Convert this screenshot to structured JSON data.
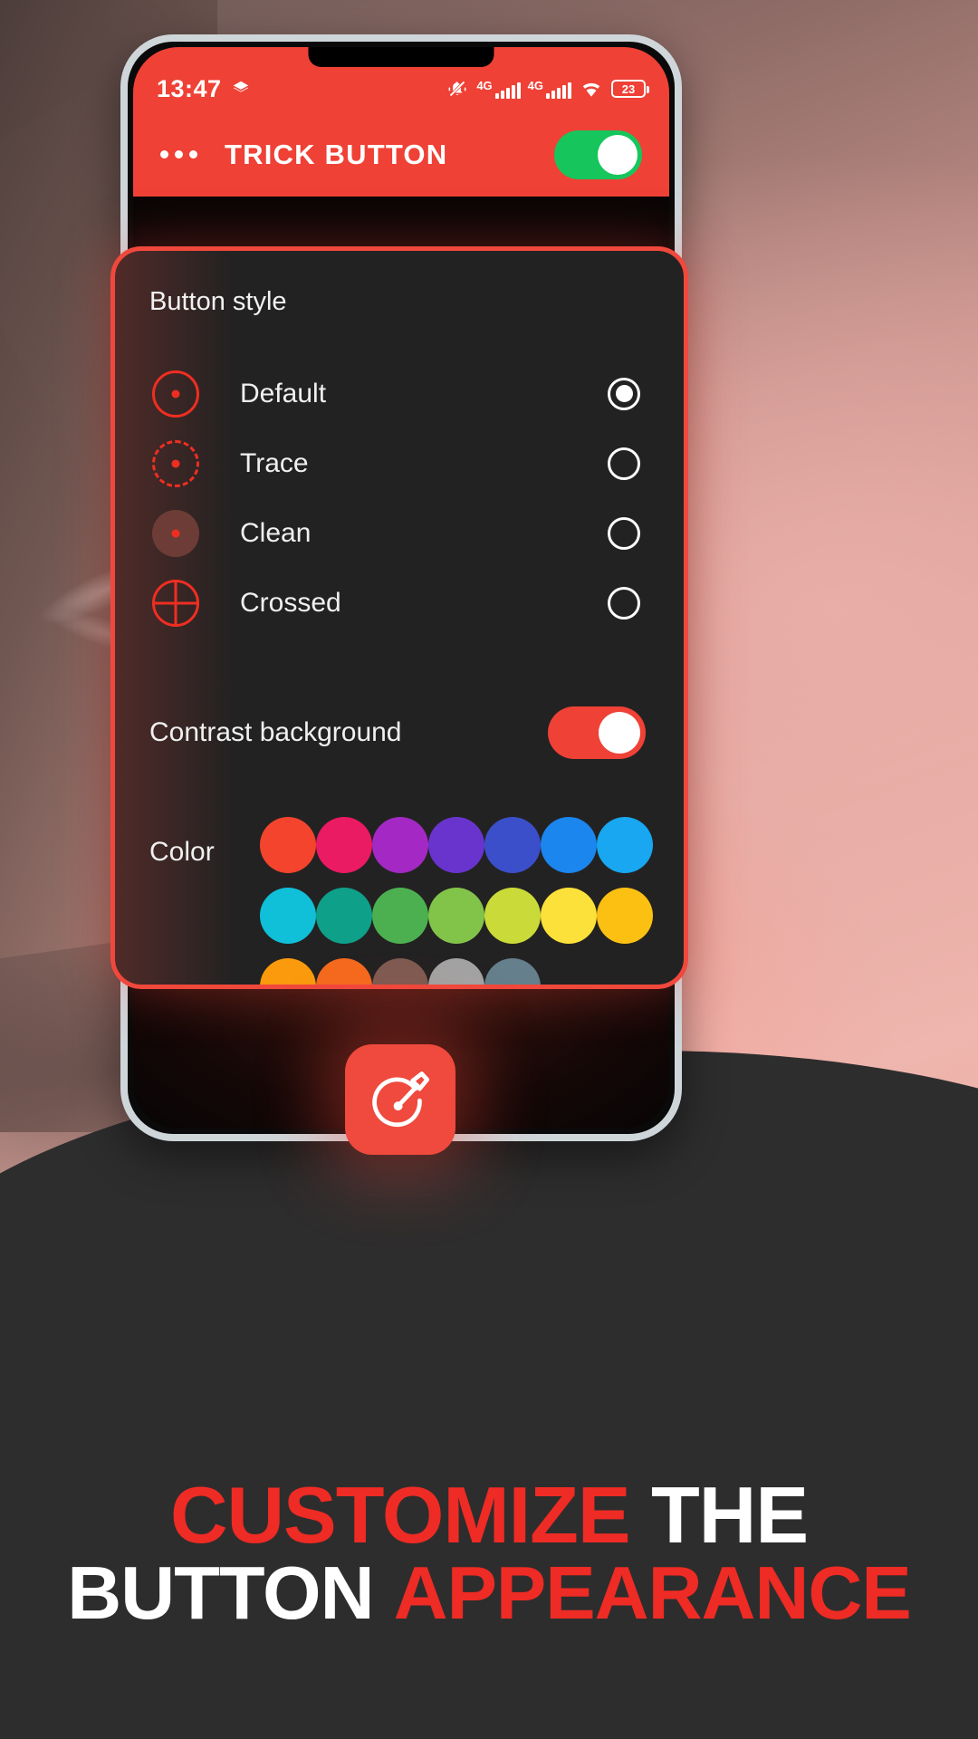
{
  "statusbar": {
    "clock": "13:47",
    "icons": [
      "layers-icon",
      "mute-bell-icon",
      "signal-4g-icon",
      "signal-4g-icon-2",
      "wifi-icon",
      "battery-icon"
    ],
    "network_label_1": "4G",
    "network_label_2": "4G",
    "battery_level": "23"
  },
  "appbar": {
    "title": "TRICK BUTTON",
    "overflow_icon": "overflow-menu-icon",
    "master_toggle_state": "on",
    "master_toggle_color": "#16c65c",
    "background_color": "#ef4136"
  },
  "dialog": {
    "border_color": "#f1483c",
    "background_color": "#232222",
    "button_style": {
      "title": "Button style",
      "selected": "Default",
      "options": [
        {
          "label": "Default",
          "icon": "ring-solid-dot-icon",
          "selected": true
        },
        {
          "label": "Trace",
          "icon": "ring-dashed-dot-icon",
          "selected": false
        },
        {
          "label": "Clean",
          "icon": "disc-muted-dot-icon",
          "selected": false
        },
        {
          "label": "Crossed",
          "icon": "ring-crosshair-icon",
          "selected": false
        }
      ]
    },
    "contrast": {
      "label": "Contrast background",
      "state": "on",
      "toggle_color": "#ef4136"
    },
    "color": {
      "label": "Color",
      "selected": "#f4442e",
      "swatches": [
        "#f4442e",
        "#ea1a63",
        "#a429c4",
        "#6934ce",
        "#3b4fca",
        "#1a86ee",
        "#18a7f0",
        "#10bfd8",
        "#0fa08a",
        "#4cb050",
        "#82c44a",
        "#cada38",
        "#fbe139",
        "#fcc013",
        "#fb9a0d",
        "#f56a1e",
        "#7f5b52",
        "#a3a3a3",
        "#657f8c",
        "",
        ""
      ]
    }
  },
  "app_icon": {
    "name": "trick-button-app-icon",
    "background_color": "#f0493d"
  },
  "headline": {
    "line1_part1": "CUSTOMIZE",
    "line1_part2": "THE",
    "line2_part1": "BUTTON",
    "line2_part2": "APPEARANCE",
    "accent_color": "#ee2b24"
  }
}
